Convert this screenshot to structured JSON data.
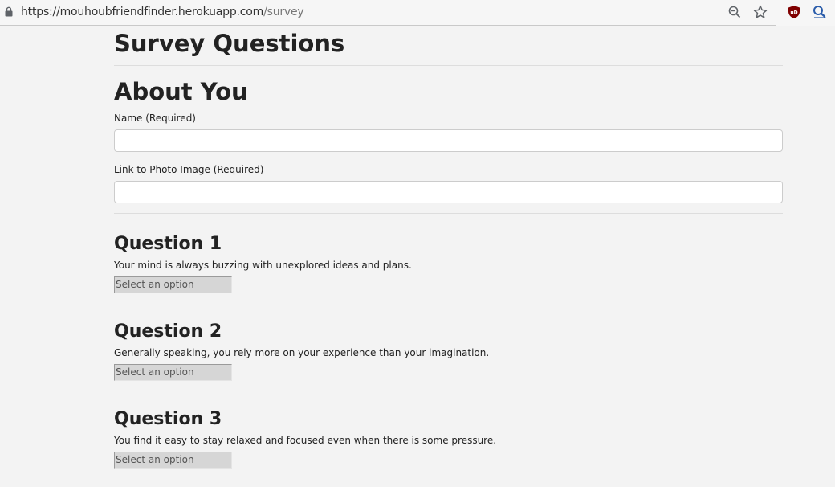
{
  "browser": {
    "url_host": "https://mouhoubfriendfinder.herokuapp.com",
    "url_path": "/survey",
    "icons": [
      "lock-icon",
      "zoom-icon",
      "star-icon",
      "ublock-icon",
      "lens-icon"
    ]
  },
  "page": {
    "title": "Survey Questions",
    "about_title": "About You",
    "name_label": "Name (Required)",
    "photo_label": "Link to Photo Image (Required)"
  },
  "questions": [
    {
      "title": "Question 1",
      "text": "Your mind is always buzzing with unexplored ideas and plans.",
      "select_placeholder": "Select an option"
    },
    {
      "title": "Question 2",
      "text": "Generally speaking, you rely more on your experience than your imagination.",
      "select_placeholder": "Select an option"
    },
    {
      "title": "Question 3",
      "text": "You find it easy to stay relaxed and focused even when there is some pressure.",
      "select_placeholder": "Select an option"
    }
  ]
}
